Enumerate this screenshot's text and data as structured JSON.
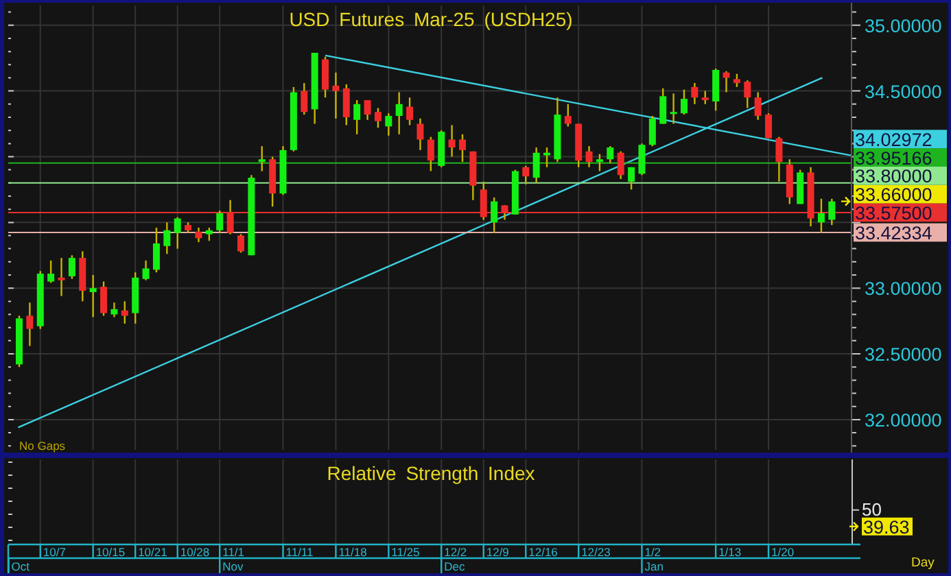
{
  "main_chart": {
    "note": "No Gaps",
    "chart_data": {
      "type": "candlestick",
      "title": "USD Futures Mar-25 (USDH25)",
      "ylim": [
        31.77,
        35.15
      ],
      "grid": true,
      "ref_lines": [
        {
          "axis": "y",
          "value": 33.95166,
          "label": "33.95166",
          "color": "#1fb41f"
        },
        {
          "axis": "y",
          "value": 33.8,
          "label": "33.80000",
          "color": "#8fe88f"
        },
        {
          "axis": "y",
          "value": 33.575,
          "label": "33.57500",
          "color": "#e83030"
        },
        {
          "axis": "y",
          "value": 33.42334,
          "label": "33.42334",
          "color": "#e8b0a8"
        }
      ],
      "yticks": [
        {
          "value": 35,
          "label": "35.00000"
        },
        {
          "value": 34.5,
          "label": "34.50000"
        },
        {
          "value": 33,
          "label": "33.00000"
        },
        {
          "value": 32.5,
          "label": "32.50000"
        },
        {
          "value": 32,
          "label": "32.00000"
        }
      ],
      "categories": [
        null,
        null,
        null,
        null,
        null,
        null,
        null,
        null,
        null,
        null,
        null,
        null,
        null,
        null,
        null,
        null,
        null,
        null,
        null,
        null,
        null,
        null,
        null,
        null,
        null,
        null,
        null,
        null,
        null,
        null,
        null,
        null,
        null,
        null,
        null,
        null,
        null,
        null,
        null,
        null,
        null,
        null,
        null,
        null,
        null,
        null,
        null,
        null,
        null,
        null,
        null,
        null,
        null,
        null,
        null,
        null,
        null,
        null,
        null,
        null,
        null,
        null,
        null,
        null,
        null,
        null,
        null,
        null,
        null,
        null,
        null,
        null,
        null,
        null,
        null,
        null,
        null,
        null
      ],
      "ohlc": [
        [
          32.42,
          32.79,
          32.4,
          32.77
        ],
        [
          32.79,
          32.89,
          32.56,
          32.69
        ],
        [
          32.71,
          33.13,
          32.69,
          33.11
        ],
        [
          33.05,
          33.21,
          33.04,
          33.11
        ],
        [
          33.08,
          33.23,
          32.94,
          33.06
        ],
        [
          33.09,
          33.25,
          33.07,
          33.23
        ],
        [
          33.23,
          33.28,
          32.9,
          32.98
        ],
        [
          32.97,
          33.1,
          32.78,
          33.0
        ],
        [
          33.01,
          33.05,
          32.79,
          32.81
        ],
        [
          32.8,
          32.89,
          32.78,
          32.84
        ],
        [
          32.83,
          32.9,
          32.73,
          32.79
        ],
        [
          32.81,
          33.12,
          32.73,
          33.08
        ],
        [
          33.07,
          33.21,
          33.06,
          33.15
        ],
        [
          33.14,
          33.46,
          33.12,
          33.34
        ],
        [
          33.32,
          33.5,
          33.26,
          33.44
        ],
        [
          33.42,
          33.54,
          33.3,
          33.53
        ],
        [
          33.48,
          33.5,
          33.42,
          33.44
        ],
        [
          33.43,
          33.46,
          33.35,
          33.38
        ],
        [
          33.41,
          33.46,
          33.36,
          33.44
        ],
        [
          33.44,
          33.59,
          33.42,
          33.57
        ],
        [
          33.58,
          33.67,
          33.41,
          33.42
        ],
        [
          33.4,
          33.41,
          33.27,
          33.28
        ],
        [
          33.25,
          33.86,
          33.25,
          33.84
        ],
        [
          33.96,
          34.08,
          33.89,
          33.98
        ],
        [
          33.98,
          34.0,
          33.62,
          33.72
        ],
        [
          33.72,
          34.08,
          33.71,
          34.05
        ],
        [
          34.05,
          34.53,
          34.04,
          34.49
        ],
        [
          34.5,
          34.56,
          34.32,
          34.34
        ],
        [
          34.36,
          34.79,
          34.25,
          34.79
        ],
        [
          34.74,
          34.76,
          34.45,
          34.51
        ],
        [
          34.54,
          34.64,
          34.29,
          34.5
        ],
        [
          34.52,
          34.55,
          34.24,
          34.3
        ],
        [
          34.28,
          34.43,
          34.17,
          34.4
        ],
        [
          34.43,
          34.43,
          34.28,
          34.32
        ],
        [
          34.34,
          34.37,
          34.22,
          34.27
        ],
        [
          34.23,
          34.33,
          34.16,
          34.31
        ],
        [
          34.31,
          34.49,
          34.17,
          34.4
        ],
        [
          34.38,
          34.45,
          34.24,
          34.28
        ],
        [
          34.25,
          34.29,
          34.05,
          34.13
        ],
        [
          34.13,
          34.15,
          33.89,
          33.97
        ],
        [
          33.93,
          34.2,
          33.92,
          34.19
        ],
        [
          34.13,
          34.24,
          34.0,
          34.07
        ],
        [
          34.13,
          34.17,
          33.96,
          34.05
        ],
        [
          34.04,
          34.04,
          33.67,
          33.78
        ],
        [
          33.75,
          33.81,
          33.52,
          33.54
        ],
        [
          33.5,
          33.69,
          33.42,
          33.66
        ],
        [
          33.63,
          33.63,
          33.52,
          33.57
        ],
        [
          33.56,
          33.9,
          33.56,
          33.89
        ],
        [
          33.92,
          33.93,
          33.79,
          33.85
        ],
        [
          33.84,
          34.07,
          33.8,
          34.03
        ],
        [
          34.01,
          34.07,
          33.92,
          34.03
        ],
        [
          33.98,
          34.45,
          33.96,
          34.32
        ],
        [
          34.31,
          34.4,
          34.23,
          34.25
        ],
        [
          34.25,
          34.25,
          33.92,
          33.97
        ],
        [
          34.04,
          34.08,
          33.92,
          33.96
        ],
        [
          33.96,
          34.02,
          33.89,
          33.98
        ],
        [
          33.98,
          34.08,
          33.95,
          34.07
        ],
        [
          34.03,
          34.04,
          33.83,
          33.86
        ],
        [
          33.81,
          33.92,
          33.75,
          33.92
        ],
        [
          33.87,
          34.1,
          33.86,
          34.09
        ],
        [
          34.09,
          34.31,
          34.08,
          34.29
        ],
        [
          34.25,
          34.52,
          34.25,
          34.46
        ],
        [
          34.33,
          34.48,
          34.25,
          34.34
        ],
        [
          34.33,
          34.51,
          34.32,
          34.44
        ],
        [
          34.53,
          34.56,
          34.4,
          34.45
        ],
        [
          34.45,
          34.5,
          34.4,
          34.43
        ],
        [
          34.42,
          34.67,
          34.35,
          34.66
        ],
        [
          34.64,
          34.65,
          34.49,
          34.6
        ],
        [
          34.59,
          34.63,
          34.53,
          34.56
        ],
        [
          34.57,
          34.58,
          34.37,
          34.45
        ],
        [
          34.45,
          34.49,
          34.28,
          34.31
        ],
        [
          34.32,
          34.33,
          34.14,
          34.14
        ],
        [
          34.14,
          34.15,
          33.81,
          33.96
        ],
        [
          33.94,
          33.98,
          33.64,
          33.69
        ],
        [
          33.64,
          33.9,
          33.64,
          33.88
        ],
        [
          33.88,
          33.92,
          33.47,
          33.53
        ],
        [
          33.5,
          33.68,
          33.42,
          33.57
        ],
        [
          33.52,
          33.68,
          33.48,
          33.66
        ]
      ]
    },
    "price_tags": [
      {
        "label": "34.02972",
        "color": "#3ccfe0"
      },
      {
        "label": "33.66000",
        "color": "#f0e800"
      }
    ]
  },
  "rsi_panel": {
    "title": "Relative Strength Index",
    "level_label": "50",
    "last_value": "39.63"
  },
  "date_axis": {
    "days": [
      "10/7",
      "10/15",
      "10/21",
      "10/28",
      "11/1",
      "11/11",
      "11/18",
      "11/25",
      "12/2",
      "12/9",
      "12/16",
      "12/23",
      "1/2",
      "1/13",
      "1/20"
    ],
    "months": [
      "Oct",
      "Nov",
      "Dec",
      "Jan"
    ]
  },
  "period": "Day"
}
